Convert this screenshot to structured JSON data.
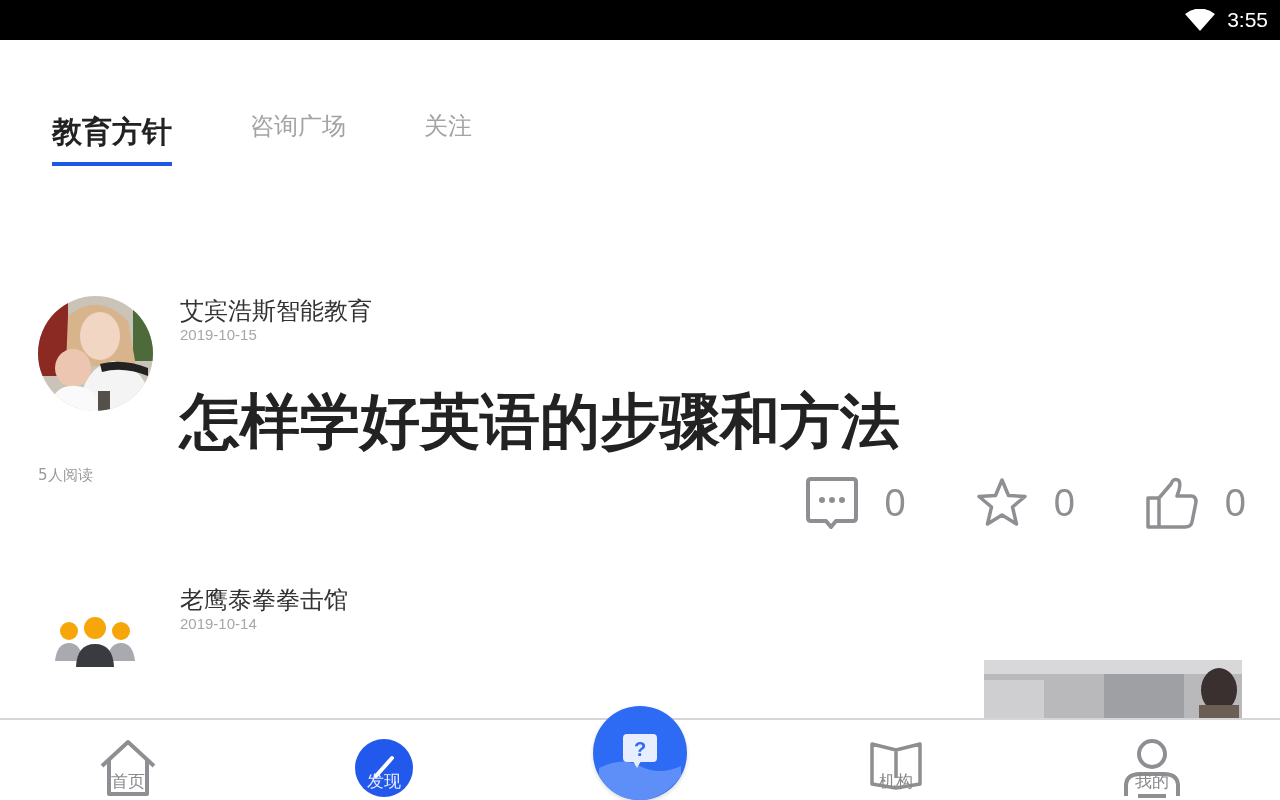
{
  "status_bar": {
    "time": "3:55"
  },
  "tabs": [
    {
      "label": "教育方针",
      "selected": true
    },
    {
      "label": "咨询广场",
      "selected": false
    },
    {
      "label": "关注",
      "selected": false
    }
  ],
  "posts": [
    {
      "author": "艾宾浩斯智能教育",
      "date": "2019-10-15",
      "title": "怎样学好英语的步骤和方法",
      "reads": "5人阅读",
      "comments": "0",
      "favorites": "0",
      "likes": "0"
    },
    {
      "avatar": {
        "kind": "group"
      },
      "author": "老鹰泰拳拳击馆",
      "date": "2019-10-14"
    }
  ],
  "nav": [
    {
      "kind": "home",
      "label": "首页",
      "selected": false
    },
    {
      "kind": "discover",
      "label": "发现",
      "selected": true
    },
    {
      "kind": "ask",
      "label": "?",
      "selected": false
    },
    {
      "kind": "org",
      "label": "机构",
      "selected": false
    },
    {
      "kind": "me",
      "label": "我的",
      "selected": false
    }
  ]
}
